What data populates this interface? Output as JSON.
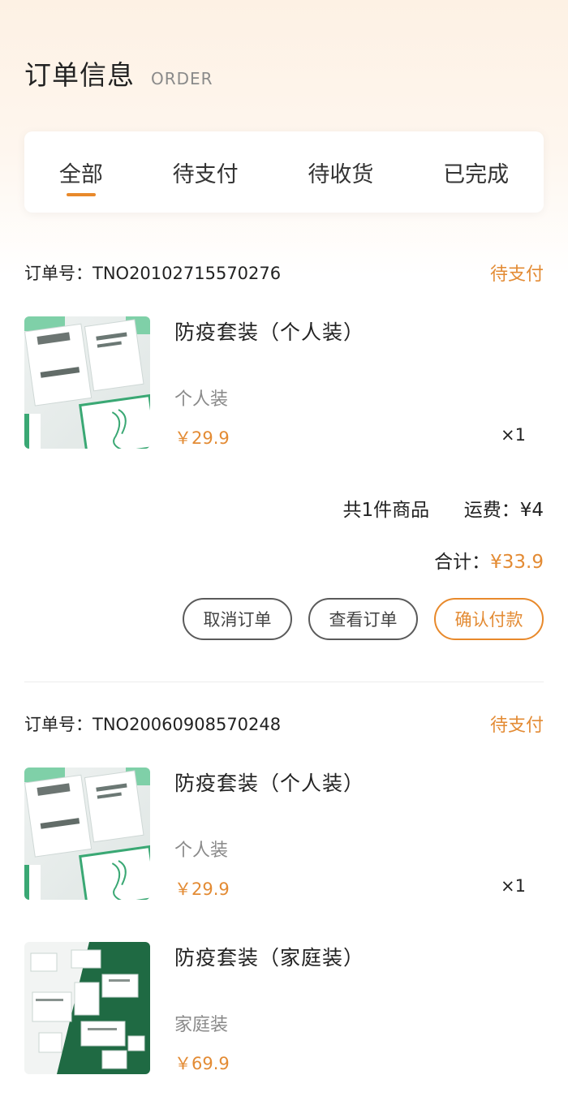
{
  "header": {
    "title": "订单信息",
    "subtitle": "ORDER"
  },
  "tabs": [
    {
      "label": "全部",
      "active": true
    },
    {
      "label": "待支付",
      "active": false
    },
    {
      "label": "待收货",
      "active": false
    },
    {
      "label": "已完成",
      "active": false
    }
  ],
  "orders": [
    {
      "order_no": "订单号：TNO20102715570276",
      "status": "待支付",
      "items": [
        {
          "name": "防疫套装（个人装）",
          "spec": "个人装",
          "price": "￥29.9",
          "qty": "×1",
          "image": "personal-kit-image"
        }
      ],
      "summary": {
        "count_text": "共1件商品",
        "shipping_label": "运费：",
        "shipping_value": "¥4",
        "total_label": "合计：",
        "total_value": "¥33.9"
      },
      "buttons": {
        "cancel": "取消订单",
        "view": "查看订单",
        "pay": "确认付款"
      }
    },
    {
      "order_no": "订单号：TNO20060908570248",
      "status": "待支付",
      "items": [
        {
          "name": "防疫套装（个人装）",
          "spec": "个人装",
          "price": "￥29.9",
          "qty": "×1",
          "image": "personal-kit-image"
        },
        {
          "name": "防疫套装（家庭装）",
          "spec": "家庭装",
          "price": "￥69.9",
          "qty": "",
          "image": "family-kit-image"
        }
      ]
    }
  ],
  "colors": {
    "accent": "#e38b34",
    "tab_indicator": "#e8892b",
    "button_gray": "#5a5a5a",
    "kit_green": "#1f6a43"
  }
}
